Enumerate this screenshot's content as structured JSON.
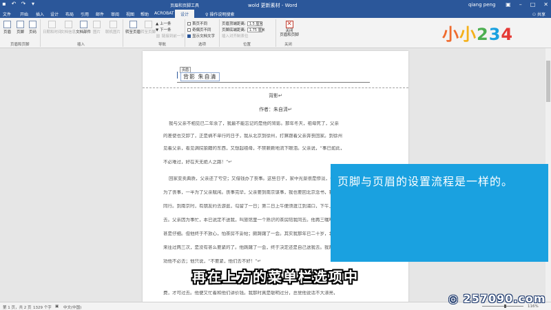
{
  "window": {
    "title": "wold 更新素材 - Word",
    "tools_tab_label": "页眉和页脚工具",
    "user": "qiang peng",
    "buttons": [
      "restore-icon",
      "minimize-icon",
      "maximize-icon",
      "close-icon"
    ]
  },
  "qat_icons": [
    "save-icon",
    "undo-icon",
    "redo-icon",
    "customize-icon"
  ],
  "tabs": [
    {
      "label": "文件"
    },
    {
      "label": "开始"
    },
    {
      "label": "插入"
    },
    {
      "label": "设计"
    },
    {
      "label": "布局"
    },
    {
      "label": "引用"
    },
    {
      "label": "邮件"
    },
    {
      "label": "审阅"
    },
    {
      "label": "视图"
    },
    {
      "label": "帮助"
    },
    {
      "label": "ACROBAT"
    },
    {
      "label": "设计",
      "active": true
    }
  ],
  "tellme": "操作说明搜索",
  "share": "共享",
  "ribbon": {
    "groups": {
      "header_footer": "页眉和页脚",
      "insert": "插入",
      "navigation": "导航",
      "options": "选项",
      "position": "位置",
      "close": "关闭"
    },
    "buttons": {
      "header": "页眉",
      "footer": "页脚",
      "page_number": "页码",
      "date_time": "日期和时间",
      "doc_info": "文档信息",
      "doc_parts": "文档部件",
      "picture": "图片",
      "online_picture": "联机图片",
      "goto_header": "转至页眉",
      "goto_footer": "转至页脚",
      "previous": "上一条",
      "next": "下一条",
      "link_previous": "链接到前一节",
      "close_header_footer": "关闭\n页眉和页脚"
    },
    "options": {
      "first_page_diff": "首页不同",
      "odd_even_diff": "奇偶页不同",
      "show_doc_text": "显示文档文字"
    },
    "position": {
      "header_from_top_label": "页眉顶端距离:",
      "header_from_top_value": "1.5 厘米",
      "footer_from_bottom_label": "页脚底端距离:",
      "footer_from_bottom_value": "1.75 厘米",
      "insert_alignment_tab": "插入对齐制表位"
    }
  },
  "logo": {
    "text": "小小234",
    "colors": [
      "#ef6b2e",
      "#f4b01a",
      "#4caf50",
      "#1aa1e0",
      "#e53935",
      "#8e44ad"
    ]
  },
  "document": {
    "header_tag": "页眉",
    "header_text": "背影 朱自清",
    "header_side_tag": "页眉",
    "title": "背影↵",
    "author": "作者：朱自清↵",
    "paragraphs": [
      "我与父亲不相见已二年余了，我最不能忘记的是他的背影。那年冬天，祖母死了，父亲",
      "的差使也交卸了，正是祸不单行的日子，我从北京到徐州，打算跟着父亲奔丧回家。到徐州",
      "见着父亲，看见满院狼藉的东西，又想起祖母，不禁簌簌地流下眼泪。父亲说，“事已如此，",
      "不必难过，好在天无绝人之路！”↵",
      "回家变卖典质，父亲还了亏空；又借钱办了丧事。这些日子，家中光景很是惨淡，一半",
      "为了丧事，一半为了父亲赋闲。丧事完毕，父亲要到南京谋事，我也要回北京念书，我们便",
      "同行。到南京时，有朋友约去游逛，勾留了一日；第二日上午便须渡江到浦口，下午上车北",
      "去。父亲因为事忙，本已说定不送我，叫旅馆里一个熟识的茶房陪我同去。他再三嘱咐茶房，",
      "甚是仔细。但他终于不放心，怕茶房不妥帖；颇踌躇了一会。其实我那年已二十岁，北京已",
      "来往过两三次，是没有甚么要紧的了。他踌躇了一会，终于决定还是自己送我去。我两三回",
      "劝他不必去；他只说，“不要紧，他们去不好！”↵",
      "费，才可过去。他便又忙着和他们讲价钱。我那时真是聪明过分，总觉他说话不大漂亮，"
    ]
  },
  "overlay": {
    "blue_card_text": "页脚与页眉的设置流程是一样的。",
    "subtitle": "再在上方的菜单栏选项中"
  },
  "status": {
    "page": "第 1 页，共 2 页",
    "words": "1329 个字",
    "language": "中文(中国)",
    "zoom": "116%"
  },
  "watermark": "257090.com"
}
